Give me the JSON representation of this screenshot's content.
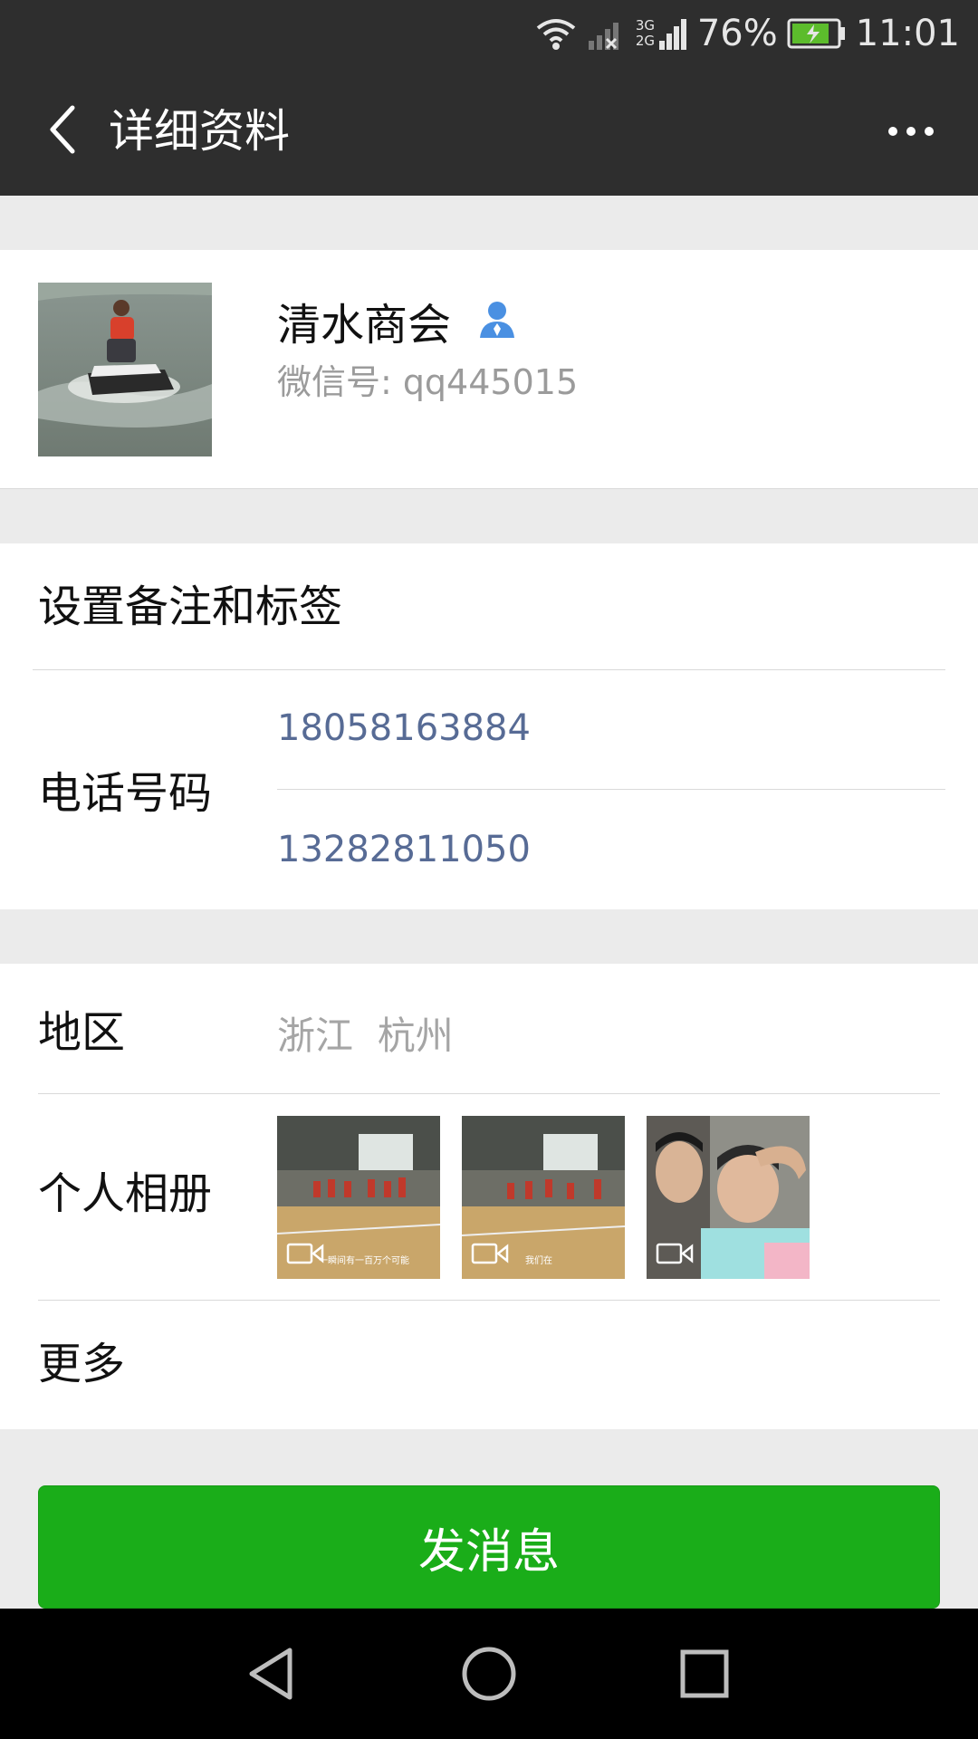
{
  "status_bar": {
    "network": "3G 2G",
    "battery_percent": "76%",
    "time": "11:01"
  },
  "nav": {
    "title": "详细资料",
    "back_icon": "back-chevron-icon",
    "more_icon": "more-dots-icon"
  },
  "profile": {
    "name": "清水商会",
    "gender_icon": "male-user-icon",
    "wechat_id_label": "微信号:",
    "wechat_id": "qq445015"
  },
  "info": {
    "remark_label": "设置备注和标签",
    "phone_label": "电话号码",
    "phones": [
      "18058163884",
      "13282811050"
    ]
  },
  "details": {
    "region_label": "地区",
    "region_value": "浙江  杭州",
    "album_label": "个人相册",
    "more_label": "更多",
    "album_captions": [
      "一瞬间有一百万个可能",
      "我们在",
      ""
    ]
  },
  "actions": {
    "send_message": "发消息"
  },
  "colors": {
    "header": "#2e2e2e",
    "accent_green": "#1aad19",
    "link_blue": "#576b95",
    "page_bg": "#ebebeb"
  }
}
